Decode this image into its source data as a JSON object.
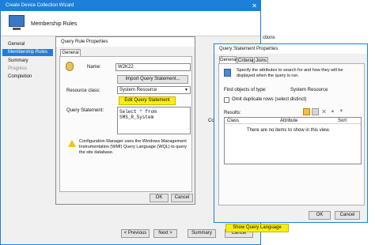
{
  "wizard": {
    "title": "Create Device Collection Wizard",
    "page_heading": "Membership Rules",
    "nav": [
      "General",
      "Membership Rules",
      "Summary",
      "Progress",
      "Completion"
    ],
    "partial_heading": "ctions",
    "partial_label": "Collec",
    "buttons": {
      "previous": "< Previous",
      "next": "Next >",
      "summary": "Summary",
      "cancel": "Cancel"
    }
  },
  "query_rule": {
    "title": "Query Rule Properties",
    "tab": "General",
    "name_label": "Name:",
    "name_value": "W2K22",
    "import_button": "Import Query Statement...",
    "resource_class_label": "Resource class:",
    "resource_class_value": "System Resource",
    "edit_button": "Edit Query Statement",
    "query_statement_label": "Query Statement:",
    "query_text_line1": "Select * from",
    "query_text_line2": "SMS_R_System",
    "info_text": "Configuration Manager uses the Windows Management Instrumentation (WMI) Query Language (WQL) to query the site database.",
    "ok": "OK",
    "cancel": "Cancel"
  },
  "statement_props": {
    "title": "Query Statement Properties",
    "tabs": [
      "General",
      "Criteria",
      "Joins"
    ],
    "description": "Specify the attributes to search for and how they will be displayed when the query is run.",
    "find_label": "Find objects of type:",
    "find_value": "System Resource",
    "omit_label": "Omit duplicate rows (select distinct)",
    "results_label": "Results:",
    "columns": [
      "Class",
      "Attribute",
      "Sort"
    ],
    "empty_text": "There are no items to show in this view.",
    "show_query_button": "Show Query Language",
    "ok": "OK",
    "cancel": "Cancel",
    "accent": "#1e7fd8"
  }
}
